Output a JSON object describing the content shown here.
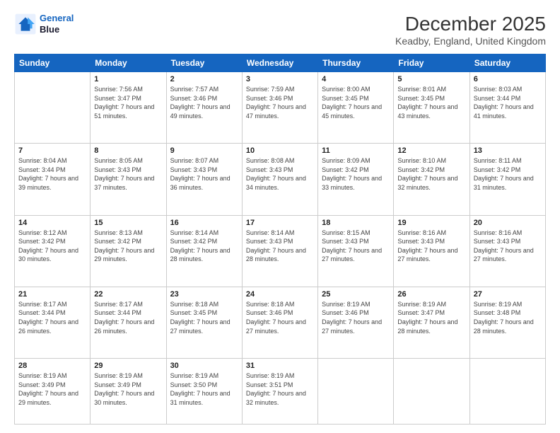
{
  "logo": {
    "line1": "General",
    "line2": "Blue"
  },
  "title": "December 2025",
  "subtitle": "Keadby, England, United Kingdom",
  "days": [
    "Sunday",
    "Monday",
    "Tuesday",
    "Wednesday",
    "Thursday",
    "Friday",
    "Saturday"
  ],
  "weeks": [
    [
      {
        "day": "",
        "sunrise": "",
        "sunset": "",
        "daylight": ""
      },
      {
        "day": "1",
        "sunrise": "Sunrise: 7:56 AM",
        "sunset": "Sunset: 3:47 PM",
        "daylight": "Daylight: 7 hours and 51 minutes."
      },
      {
        "day": "2",
        "sunrise": "Sunrise: 7:57 AM",
        "sunset": "Sunset: 3:46 PM",
        "daylight": "Daylight: 7 hours and 49 minutes."
      },
      {
        "day": "3",
        "sunrise": "Sunrise: 7:59 AM",
        "sunset": "Sunset: 3:46 PM",
        "daylight": "Daylight: 7 hours and 47 minutes."
      },
      {
        "day": "4",
        "sunrise": "Sunrise: 8:00 AM",
        "sunset": "Sunset: 3:45 PM",
        "daylight": "Daylight: 7 hours and 45 minutes."
      },
      {
        "day": "5",
        "sunrise": "Sunrise: 8:01 AM",
        "sunset": "Sunset: 3:45 PM",
        "daylight": "Daylight: 7 hours and 43 minutes."
      },
      {
        "day": "6",
        "sunrise": "Sunrise: 8:03 AM",
        "sunset": "Sunset: 3:44 PM",
        "daylight": "Daylight: 7 hours and 41 minutes."
      }
    ],
    [
      {
        "day": "7",
        "sunrise": "Sunrise: 8:04 AM",
        "sunset": "Sunset: 3:44 PM",
        "daylight": "Daylight: 7 hours and 39 minutes."
      },
      {
        "day": "8",
        "sunrise": "Sunrise: 8:05 AM",
        "sunset": "Sunset: 3:43 PM",
        "daylight": "Daylight: 7 hours and 37 minutes."
      },
      {
        "day": "9",
        "sunrise": "Sunrise: 8:07 AM",
        "sunset": "Sunset: 3:43 PM",
        "daylight": "Daylight: 7 hours and 36 minutes."
      },
      {
        "day": "10",
        "sunrise": "Sunrise: 8:08 AM",
        "sunset": "Sunset: 3:43 PM",
        "daylight": "Daylight: 7 hours and 34 minutes."
      },
      {
        "day": "11",
        "sunrise": "Sunrise: 8:09 AM",
        "sunset": "Sunset: 3:42 PM",
        "daylight": "Daylight: 7 hours and 33 minutes."
      },
      {
        "day": "12",
        "sunrise": "Sunrise: 8:10 AM",
        "sunset": "Sunset: 3:42 PM",
        "daylight": "Daylight: 7 hours and 32 minutes."
      },
      {
        "day": "13",
        "sunrise": "Sunrise: 8:11 AM",
        "sunset": "Sunset: 3:42 PM",
        "daylight": "Daylight: 7 hours and 31 minutes."
      }
    ],
    [
      {
        "day": "14",
        "sunrise": "Sunrise: 8:12 AM",
        "sunset": "Sunset: 3:42 PM",
        "daylight": "Daylight: 7 hours and 30 minutes."
      },
      {
        "day": "15",
        "sunrise": "Sunrise: 8:13 AM",
        "sunset": "Sunset: 3:42 PM",
        "daylight": "Daylight: 7 hours and 29 minutes."
      },
      {
        "day": "16",
        "sunrise": "Sunrise: 8:14 AM",
        "sunset": "Sunset: 3:42 PM",
        "daylight": "Daylight: 7 hours and 28 minutes."
      },
      {
        "day": "17",
        "sunrise": "Sunrise: 8:14 AM",
        "sunset": "Sunset: 3:43 PM",
        "daylight": "Daylight: 7 hours and 28 minutes."
      },
      {
        "day": "18",
        "sunrise": "Sunrise: 8:15 AM",
        "sunset": "Sunset: 3:43 PM",
        "daylight": "Daylight: 7 hours and 27 minutes."
      },
      {
        "day": "19",
        "sunrise": "Sunrise: 8:16 AM",
        "sunset": "Sunset: 3:43 PM",
        "daylight": "Daylight: 7 hours and 27 minutes."
      },
      {
        "day": "20",
        "sunrise": "Sunrise: 8:16 AM",
        "sunset": "Sunset: 3:43 PM",
        "daylight": "Daylight: 7 hours and 27 minutes."
      }
    ],
    [
      {
        "day": "21",
        "sunrise": "Sunrise: 8:17 AM",
        "sunset": "Sunset: 3:44 PM",
        "daylight": "Daylight: 7 hours and 26 minutes."
      },
      {
        "day": "22",
        "sunrise": "Sunrise: 8:17 AM",
        "sunset": "Sunset: 3:44 PM",
        "daylight": "Daylight: 7 hours and 26 minutes."
      },
      {
        "day": "23",
        "sunrise": "Sunrise: 8:18 AM",
        "sunset": "Sunset: 3:45 PM",
        "daylight": "Daylight: 7 hours and 27 minutes."
      },
      {
        "day": "24",
        "sunrise": "Sunrise: 8:18 AM",
        "sunset": "Sunset: 3:46 PM",
        "daylight": "Daylight: 7 hours and 27 minutes."
      },
      {
        "day": "25",
        "sunrise": "Sunrise: 8:19 AM",
        "sunset": "Sunset: 3:46 PM",
        "daylight": "Daylight: 7 hours and 27 minutes."
      },
      {
        "day": "26",
        "sunrise": "Sunrise: 8:19 AM",
        "sunset": "Sunset: 3:47 PM",
        "daylight": "Daylight: 7 hours and 28 minutes."
      },
      {
        "day": "27",
        "sunrise": "Sunrise: 8:19 AM",
        "sunset": "Sunset: 3:48 PM",
        "daylight": "Daylight: 7 hours and 28 minutes."
      }
    ],
    [
      {
        "day": "28",
        "sunrise": "Sunrise: 8:19 AM",
        "sunset": "Sunset: 3:49 PM",
        "daylight": "Daylight: 7 hours and 29 minutes."
      },
      {
        "day": "29",
        "sunrise": "Sunrise: 8:19 AM",
        "sunset": "Sunset: 3:49 PM",
        "daylight": "Daylight: 7 hours and 30 minutes."
      },
      {
        "day": "30",
        "sunrise": "Sunrise: 8:19 AM",
        "sunset": "Sunset: 3:50 PM",
        "daylight": "Daylight: 7 hours and 31 minutes."
      },
      {
        "day": "31",
        "sunrise": "Sunrise: 8:19 AM",
        "sunset": "Sunset: 3:51 PM",
        "daylight": "Daylight: 7 hours and 32 minutes."
      },
      {
        "day": "",
        "sunrise": "",
        "sunset": "",
        "daylight": ""
      },
      {
        "day": "",
        "sunrise": "",
        "sunset": "",
        "daylight": ""
      },
      {
        "day": "",
        "sunrise": "",
        "sunset": "",
        "daylight": ""
      }
    ]
  ]
}
